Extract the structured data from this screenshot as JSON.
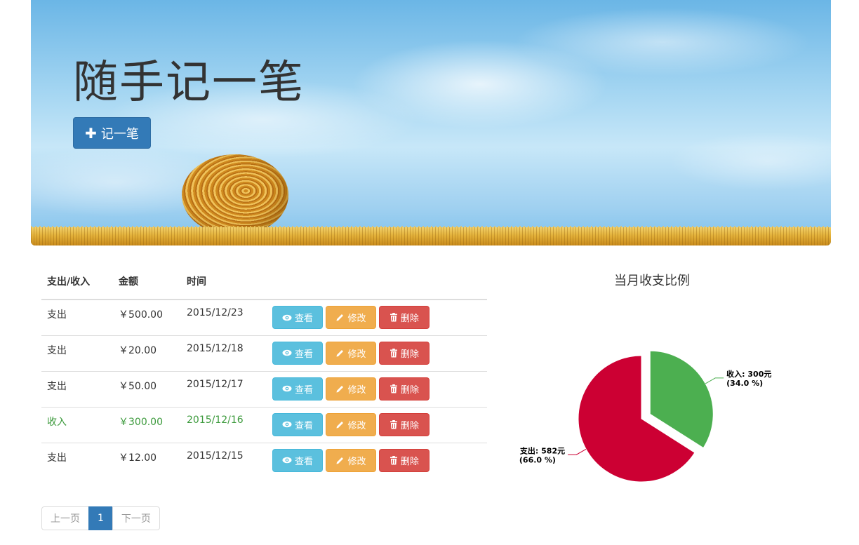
{
  "hero": {
    "title": "随手记一笔",
    "add_button_label": "记一笔"
  },
  "table": {
    "headers": [
      "支出/收入",
      "金额",
      "时间"
    ],
    "rows": [
      {
        "type": "支出",
        "amount": "￥500.00",
        "date": "2015/12/23",
        "is_income": false
      },
      {
        "type": "支出",
        "amount": "￥20.00",
        "date": "2015/12/18",
        "is_income": false
      },
      {
        "type": "支出",
        "amount": "￥50.00",
        "date": "2015/12/17",
        "is_income": false
      },
      {
        "type": "收入",
        "amount": "￥300.00",
        "date": "2015/12/16",
        "is_income": true
      },
      {
        "type": "支出",
        "amount": "￥12.00",
        "date": "2015/12/15",
        "is_income": false
      }
    ],
    "actions": {
      "view": "查看",
      "edit": "修改",
      "delete": "删除"
    }
  },
  "pagination": {
    "prev": "上一页",
    "current": "1",
    "next": "下一页"
  },
  "colors": {
    "primary": "#337ab7",
    "info": "#5bc0de",
    "warning": "#f0ad4e",
    "danger": "#d9534f",
    "income_text": "#3c9a3c",
    "pie_income": "#4caf50",
    "pie_expense": "#cc0033"
  },
  "chart_data": {
    "type": "pie",
    "title": "当月收支比例",
    "slices": [
      {
        "name": "收入",
        "value": 300,
        "percent": 34.0,
        "label_line1": "收入: 300元",
        "label_line2": "(34.0 %)",
        "color": "#4caf50",
        "exploded": true
      },
      {
        "name": "支出",
        "value": 582,
        "percent": 66.0,
        "label_line1": "支出: 582元",
        "label_line2": "(66.0 %)",
        "color": "#cc0033",
        "exploded": false
      }
    ]
  }
}
